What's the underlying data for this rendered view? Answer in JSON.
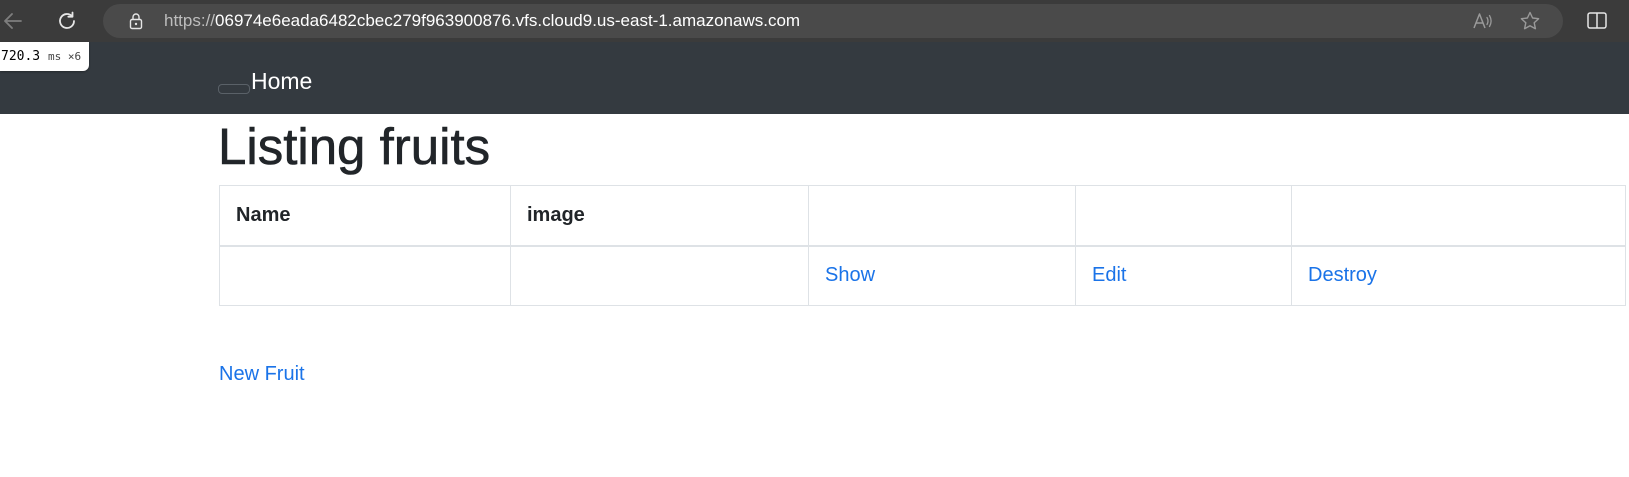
{
  "browser": {
    "url_scheme": "https://",
    "url_host": "06974e6eada6482cbec279f963900876.vfs.cloud9.us-east-1.amazonaws.com",
    "icons": [
      "back-icon",
      "reload-icon",
      "lock-icon",
      "read-aloud-icon",
      "favorite-icon",
      "split-screen-icon"
    ]
  },
  "perf_badge": {
    "value": "720.3",
    "unit": "ms ×6"
  },
  "navbar": {
    "home_label": "Home",
    "background": "#343a40"
  },
  "page": {
    "title": "Listing fruits"
  },
  "table": {
    "columns": [
      "Name",
      "image",
      "",
      "",
      ""
    ],
    "rows": [
      {
        "name": "",
        "image": "",
        "show_label": "Show",
        "edit_label": "Edit",
        "destroy_label": "Destroy"
      }
    ]
  },
  "actions": {
    "new_fruit_label": "New Fruit"
  },
  "colors": {
    "link": "#1a73e8",
    "text": "#212529",
    "border": "#dee2e6"
  }
}
